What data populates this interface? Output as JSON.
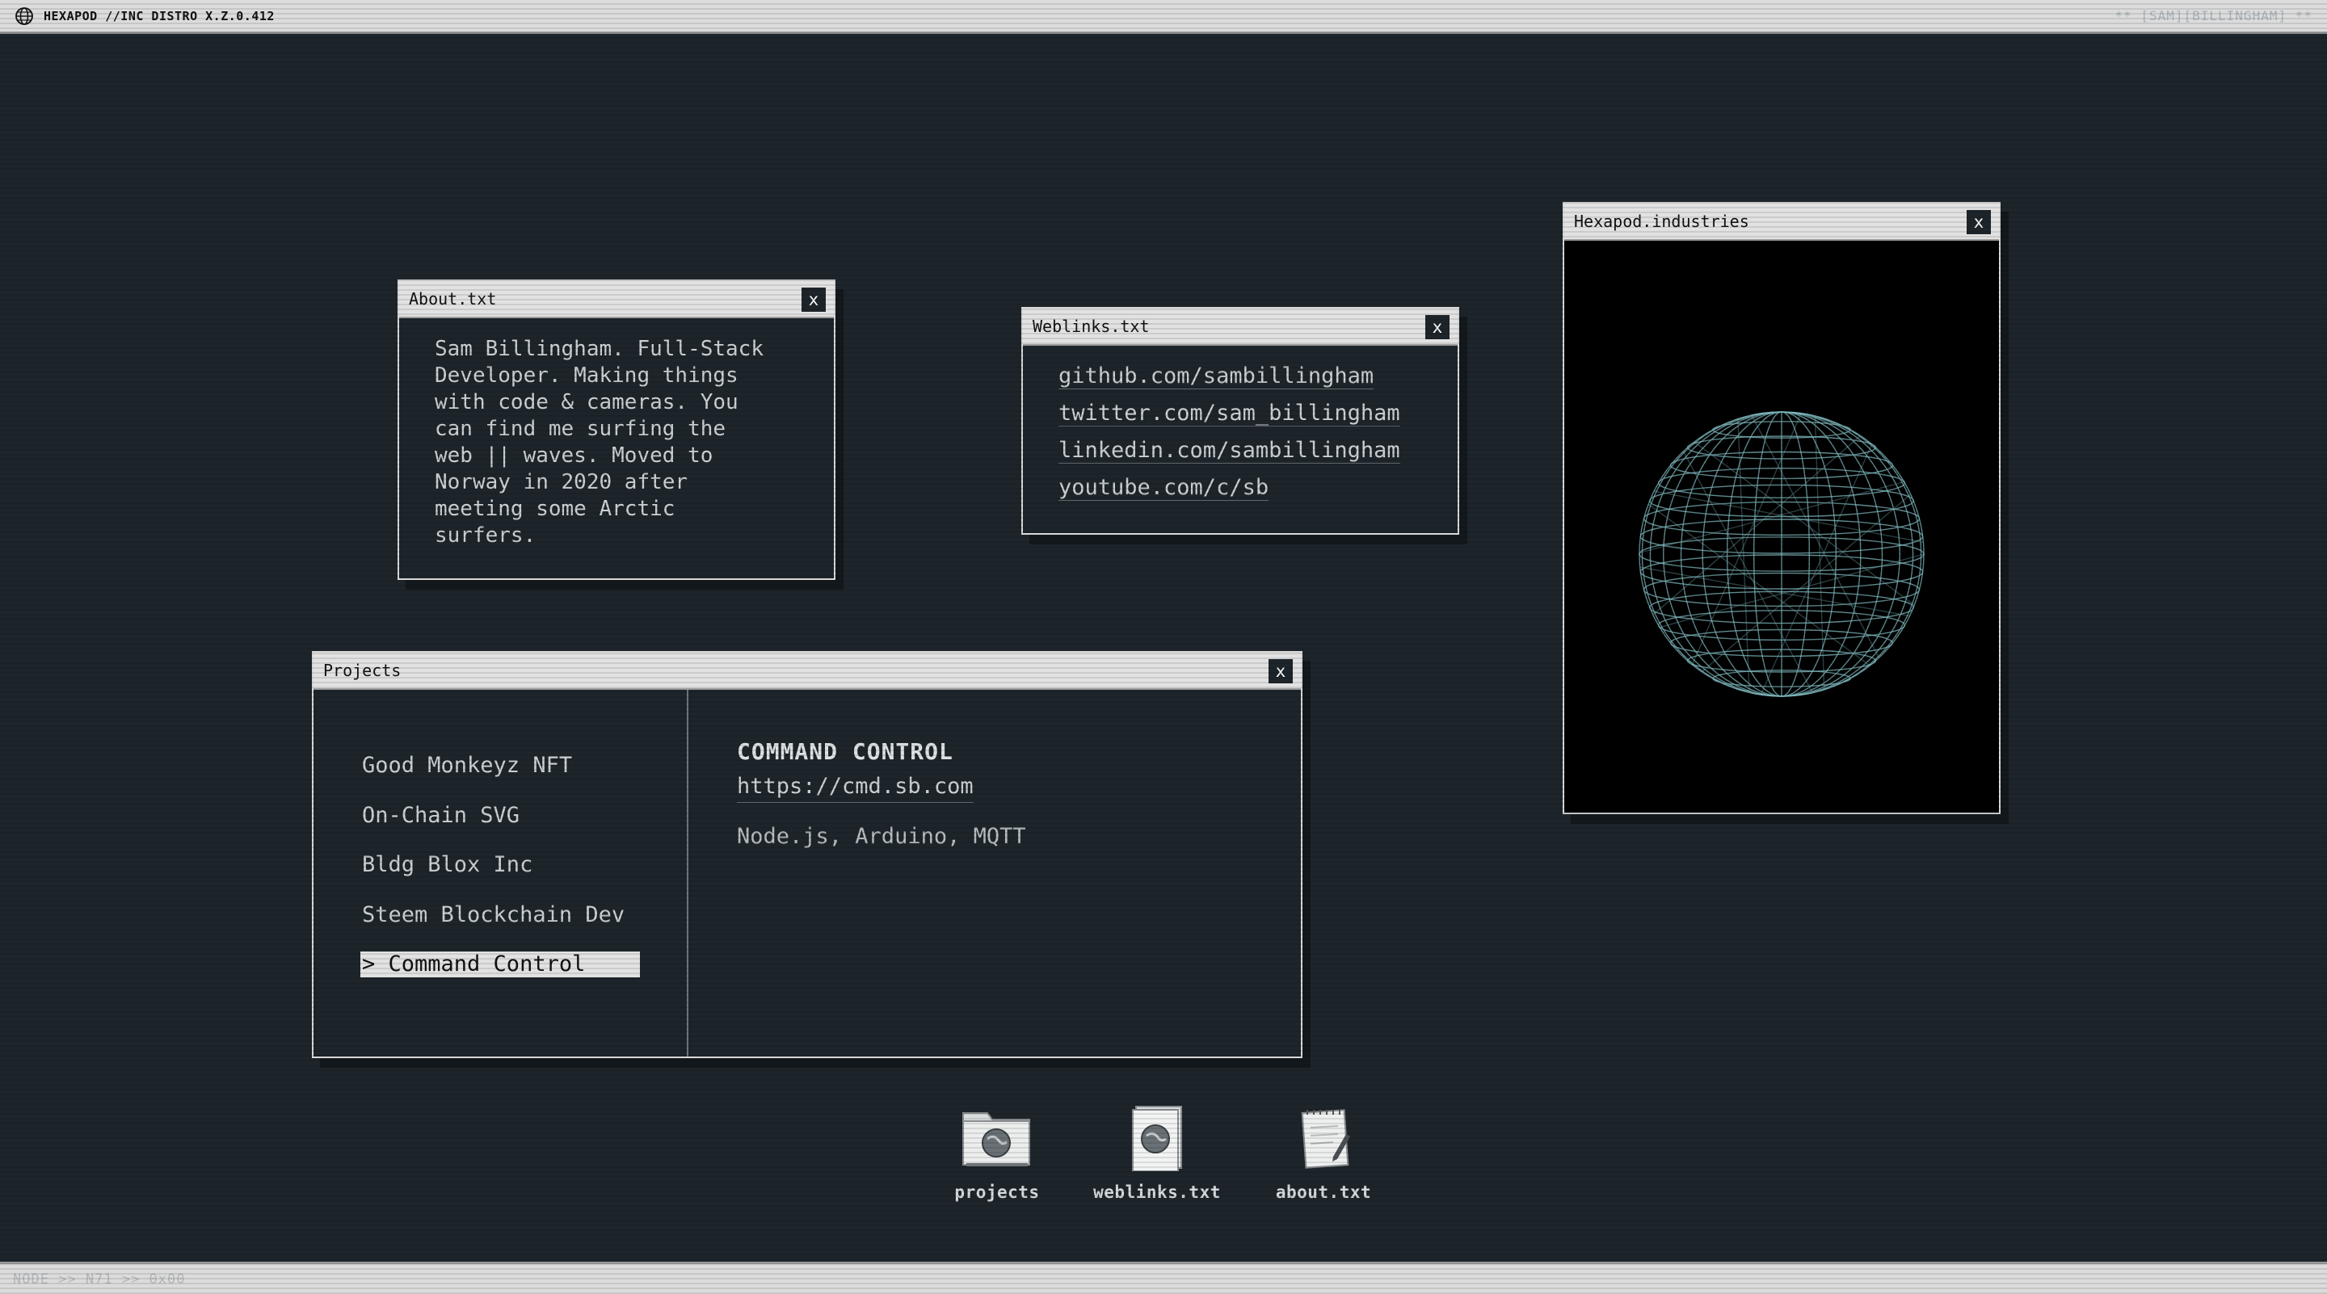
{
  "topbar": {
    "title": "HEXAPOD //INC DISTRO X.Z.0.412",
    "user": "** [SAM][BILLINGHAM] **",
    "icon": "globe-icon"
  },
  "bottombar": {
    "status": "NODE >> N71 >> 0x00"
  },
  "about": {
    "title": "About.txt",
    "close": "x",
    "text": "Sam Billingham. Full-Stack\nDeveloper. Making things\nwith code & cameras. You\ncan find me surfing the\nweb || waves. Moved to\nNorway in 2020 after\nmeeting some Arctic\nsurfers."
  },
  "weblinks": {
    "title": "Weblinks.txt",
    "close": "x",
    "links": [
      "github.com/sambillingham",
      "twitter.com/sam_billingham",
      "linkedin.com/sambillingham",
      "youtube.com/c/sb"
    ]
  },
  "hexapod": {
    "title": "Hexapod.industries",
    "close": "x",
    "graphic": "wireframe-sphere"
  },
  "projects": {
    "title": "Projects",
    "close": "x",
    "items": [
      "Good Monkeyz NFT",
      "On-Chain SVG",
      "Bldg Blox Inc",
      "Steem Blockchain Dev",
      "> Command Control"
    ],
    "selected_index": 4,
    "detail": {
      "heading": "COMMAND CONTROL",
      "url": "https://cmd.sb.com",
      "stack": "Node.js, Arduino, MQTT"
    }
  },
  "desktop_icons": [
    {
      "label": "projects",
      "icon": "folder-globe-icon"
    },
    {
      "label": "weblinks.txt",
      "icon": "document-globe-icon"
    },
    {
      "label": "about.txt",
      "icon": "notepad-icon"
    }
  ],
  "colors": {
    "background": "#1d252b",
    "titlebar": "#e2e2e2",
    "sphere": "#7fb8bd"
  }
}
